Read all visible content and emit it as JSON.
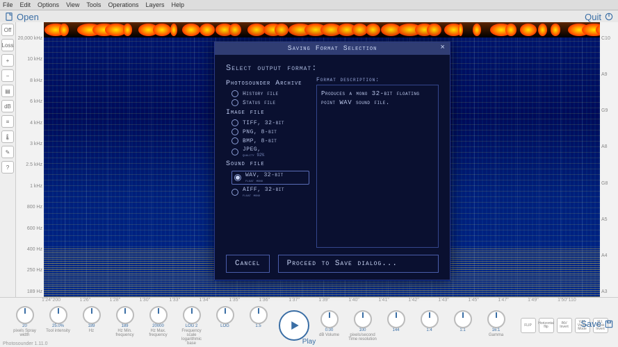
{
  "menubar": [
    "File",
    "Edit",
    "Options",
    "View",
    "Tools",
    "Operations",
    "Layers",
    "Help"
  ],
  "header": {
    "open": "Open",
    "quit": "Quit"
  },
  "left_tools": [
    {
      "name": "off-toggle",
      "label": "Off"
    },
    {
      "name": "lossless-toggle",
      "label": "Loss"
    },
    {
      "name": "add-tool",
      "label": "+"
    },
    {
      "name": "subtract-tool",
      "label": "−"
    },
    {
      "name": "layers-tool",
      "label": "▤"
    },
    {
      "name": "db-tool",
      "label": "dB"
    },
    {
      "name": "eq-tool",
      "label": "≡"
    },
    {
      "name": "thermo-tool",
      "label": "🌡"
    },
    {
      "name": "pencil-tool",
      "label": "✎"
    },
    {
      "name": "help-tool",
      "label": "?"
    }
  ],
  "left_tool_captions": {
    "off": "Off",
    "lossless": "Lossless",
    "help": "Help"
  },
  "freq_ticks": [
    "20,000 kHz",
    "10 kHz",
    "8 kHz",
    "6 kHz",
    "4 kHz",
    "3 kHz",
    "2.5 kHz",
    "1 kHz",
    "800 Hz",
    "600 Hz",
    "400 Hz",
    "250 Hz",
    "189 Hz"
  ],
  "note_ticks": [
    "C10",
    "A9",
    "G9",
    "A8",
    "G8",
    "A5",
    "A4",
    "A3"
  ],
  "time_ticks": [
    "1'24\"200",
    "1'26\"",
    "1'28\"",
    "1'30\"",
    "1'33\"",
    "1'34\"",
    "1'35\"",
    "1'36\"",
    "1'37\"",
    "1'39\"",
    "1'40\"",
    "1'41\"",
    "1'42\"",
    "1'43\"",
    "1'45\"",
    "1'47\"",
    "1'49\"",
    "1'50\"110"
  ],
  "knobs_left": [
    {
      "name": "spray-width",
      "value": "20",
      "label": "pixels\nSpray width"
    },
    {
      "name": "tool-intensity",
      "value": "25.0%",
      "label": "Tool intensity"
    },
    {
      "name": "spray-hz",
      "value": "189",
      "label": "Hz"
    },
    {
      "name": "min-freq",
      "value": "189",
      "label": "Hz\nMin. frequency"
    },
    {
      "name": "max-freq",
      "value": "20000",
      "label": "Hz\nMax. frequency"
    },
    {
      "name": "freq-scale",
      "value": "LOG 2",
      "label": "Frequency scale\nlogarithmic base"
    },
    {
      "name": "freq-scale2",
      "value": "LOG",
      "label": ""
    },
    {
      "name": "time-res-l",
      "value": "1.5",
      "label": ""
    }
  ],
  "knobs_right": [
    {
      "name": "db-vol",
      "value": "0.00",
      "label": "dB\nVolume"
    },
    {
      "name": "pps",
      "value": "100",
      "label": "pixels/second\nTime resolution"
    },
    {
      "name": "bands-per-oct",
      "value": "144",
      "label": ""
    },
    {
      "name": "ratio-a",
      "value": "1:4",
      "label": ""
    },
    {
      "name": "ratio-b",
      "value": "1:1",
      "label": ""
    },
    {
      "name": "gamma",
      "value": "16:1",
      "label": "Gamma"
    }
  ],
  "square_buttons": [
    {
      "name": "flip-btn",
      "label": "FLIP"
    },
    {
      "name": "hrip-btn",
      "label": "Horizontal flip"
    },
    {
      "name": "inv-btn",
      "label": "INV\nInvert"
    },
    {
      "name": "vm-btn",
      "label": "V.M.\nVision Mode"
    },
    {
      "name": "mi-btn",
      "label": "M.I.\nMask Invert"
    }
  ],
  "play_label": "Play",
  "save_label": "Save",
  "status": "Photosounder 1.11.0",
  "dialog": {
    "title": "Saving Format Selection",
    "heading": "Select output format:",
    "groups": [
      {
        "name": "Photosounder Archive",
        "options": [
          {
            "id": "history",
            "label": "History file"
          },
          {
            "id": "status",
            "label": "Status file"
          }
        ]
      },
      {
        "name": "Image file",
        "options": [
          {
            "id": "tiff",
            "label": "TIFF, 32-bit"
          },
          {
            "id": "png",
            "label": "PNG, 8-bit"
          },
          {
            "id": "bmp",
            "label": "BMP, 8-bit"
          },
          {
            "id": "jpeg",
            "label": "JPEG,",
            "sub": "quality 92%"
          }
        ]
      },
      {
        "name": "Sound file",
        "options": [
          {
            "id": "wav",
            "label": "WAV, 32-bit",
            "sub": "float mono",
            "selected": true
          },
          {
            "id": "aiff",
            "label": "AIFF, 32-bit",
            "sub": "float mono"
          }
        ]
      }
    ],
    "desc_label": "Format description:",
    "desc": "Produces a mono 32-bit floating point WAV sound file.",
    "cancel": "Cancel",
    "proceed": "Proceed to Save dialog..."
  }
}
